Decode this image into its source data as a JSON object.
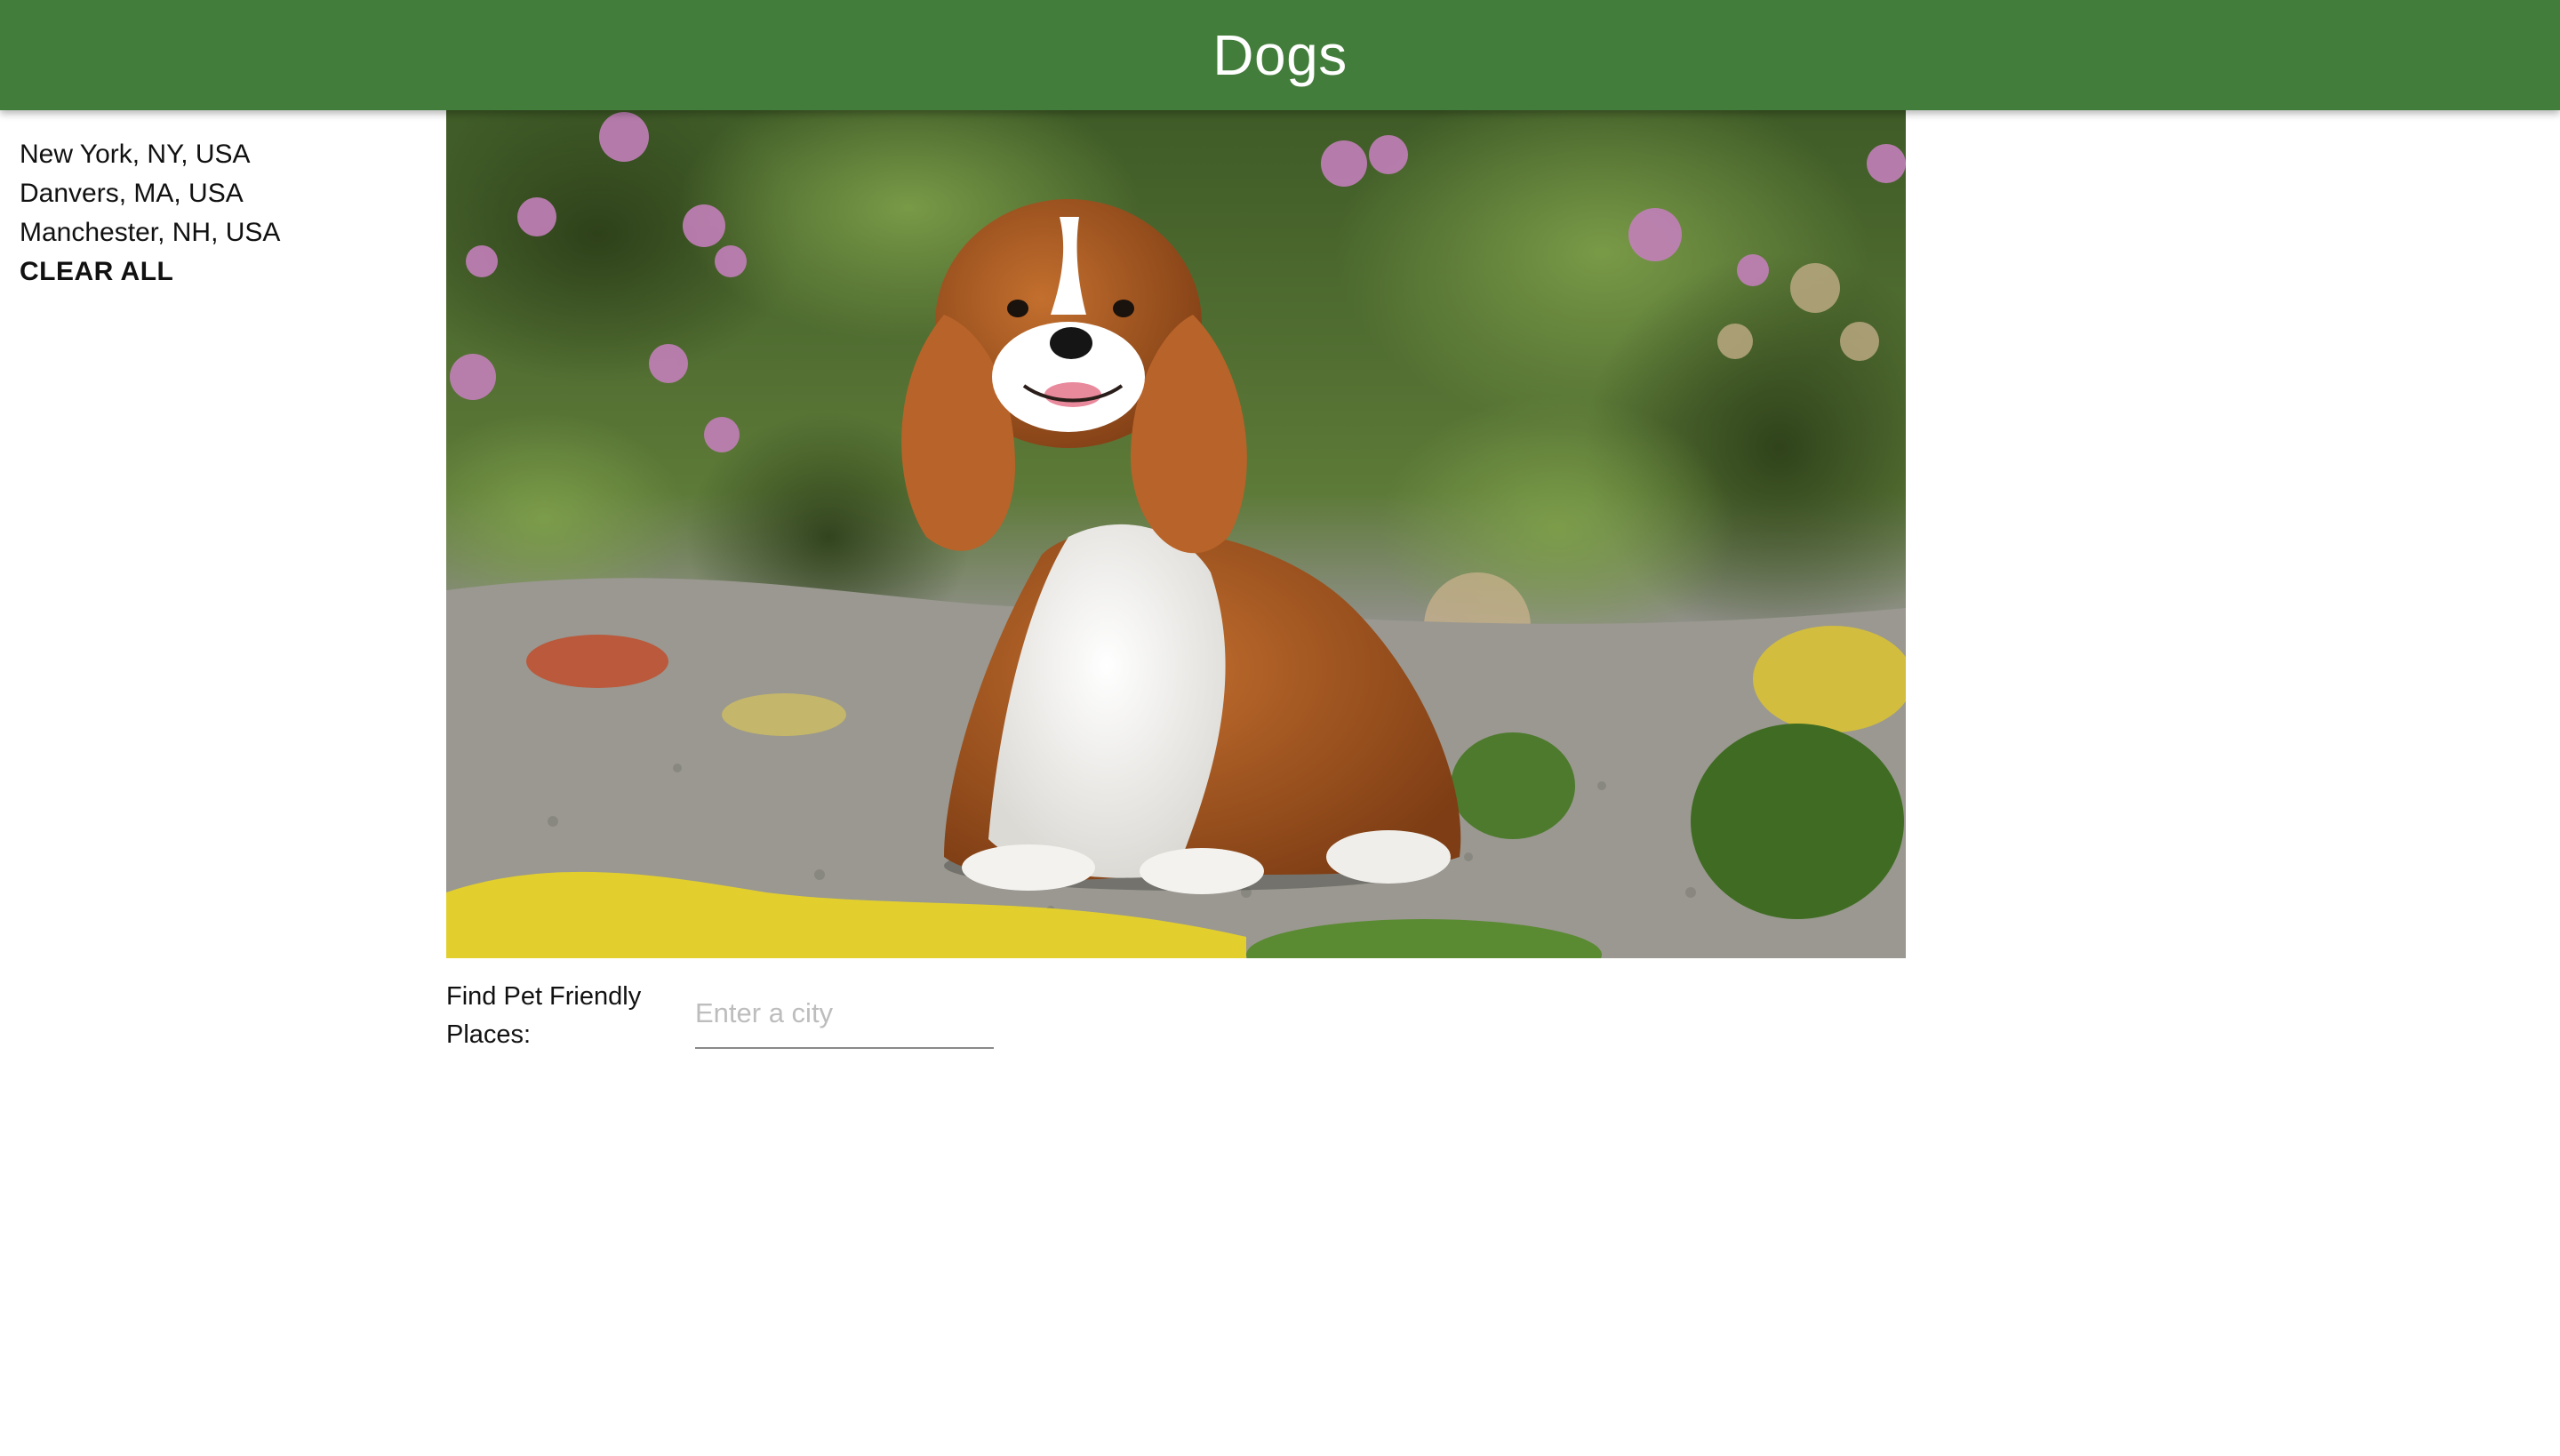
{
  "header": {
    "title": "Dogs",
    "background_color": "#437d3b"
  },
  "sidebar": {
    "cities": [
      "New York, NY, USA",
      "Danvers, MA, USA",
      "Manchester, NH, USA"
    ],
    "clear_label": "CLEAR ALL"
  },
  "main": {
    "image": {
      "subject": "Cavalier King Charles Spaniel sitting on a gravel garden path among flowers"
    },
    "search": {
      "label": "Find Pet Friendly Places:",
      "placeholder": "Enter a city",
      "value": ""
    }
  }
}
